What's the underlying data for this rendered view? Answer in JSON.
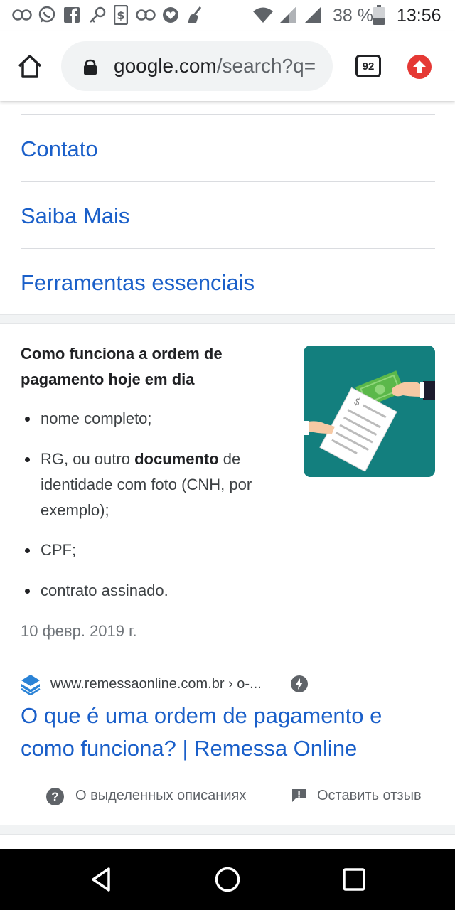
{
  "status_bar": {
    "notification_icons": [
      "infinity-icon",
      "whatsapp-icon",
      "facebook-icon",
      "key-icon",
      "dollar-icon",
      "infinity-icon",
      "heart-shield-icon",
      "broom-icon"
    ],
    "system_icons": [
      "wifi-icon",
      "signal-icon",
      "signal-icon"
    ],
    "battery_percent": "38 %",
    "time": "13:56"
  },
  "browser": {
    "url_domain": "google.com",
    "url_path": "/search?q=",
    "tab_count": "92",
    "accent_color": "#e53935"
  },
  "nav_links": [
    "Contato",
    "Saiba Mais",
    "Ferramentas essenciais"
  ],
  "featured_snippet": {
    "title": "Como funciona a ordem de pagamento hoje em dia",
    "bullets": [
      {
        "text": "nome completo;"
      },
      {
        "pre": "RG, ou outro ",
        "bold": "documento",
        "post": " de identidade com foto (CNH, por exemplo);"
      },
      {
        "text": "CPF;"
      },
      {
        "text": "contrato assinado."
      }
    ],
    "date": "10 февр. 2019 г.",
    "source_url": "www.remessaonline.com.br › o-...",
    "result_title": "O que é uma ordem de pagamento e como funciona? | Remessa Online",
    "link_color": "#1a5fc9"
  },
  "feedback": {
    "about_label": "О выделенных описаниях",
    "feedback_label": "Оставить отзыв"
  },
  "system_nav": [
    "back-icon",
    "home-circle-icon",
    "recents-icon"
  ]
}
